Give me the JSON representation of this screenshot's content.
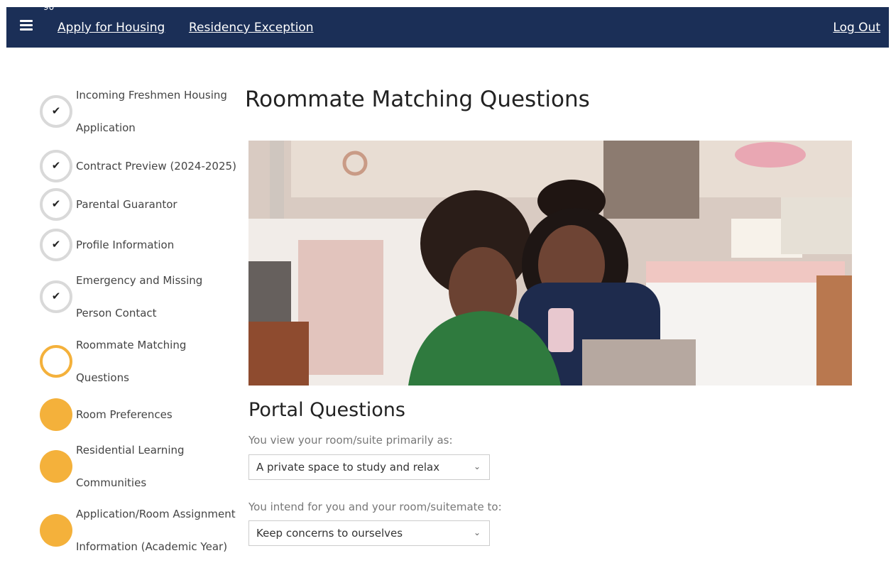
{
  "topbar": {
    "badge": "90",
    "links": [
      "Apply for Housing",
      "Residency Exception"
    ],
    "logout": "Log Out"
  },
  "steps": [
    {
      "lines": [
        "Incoming Freshmen Housing",
        "Application"
      ],
      "status": "complete"
    },
    {
      "lines": [
        "Contract Preview (2024-2025)"
      ],
      "status": "complete"
    },
    {
      "lines": [
        "Parental Guarantor"
      ],
      "status": "complete"
    },
    {
      "lines": [
        "Profile Information"
      ],
      "status": "complete"
    },
    {
      "lines": [
        "Emergency and Missing",
        "Person Contact"
      ],
      "status": "complete"
    },
    {
      "lines": [
        "Roommate Matching",
        "Questions"
      ],
      "status": "current"
    },
    {
      "lines": [
        "Room Preferences"
      ],
      "status": "pending"
    },
    {
      "lines": [
        "Residential Learning",
        "Communities"
      ],
      "status": "pending"
    },
    {
      "lines": [
        "Application/Room Assignment",
        "Information (Academic Year)"
      ],
      "status": "pending"
    }
  ],
  "main": {
    "title": "Roommate Matching Questions",
    "section_title": "Portal Questions",
    "questions": [
      {
        "label": "You view your room/suite primarily as:",
        "value": "A private space to study and relax"
      },
      {
        "label": "You intend for you and your room/suitemate to:",
        "value": "Keep concerns to ourselves"
      }
    ]
  },
  "colors": {
    "nav_bg": "#1b2f57",
    "step_pending": "#f4b13b",
    "step_done_ring": "#d9d9d9"
  },
  "icons": {
    "menu": "hamburger-menu-icon",
    "done": "checkmark-icon"
  }
}
